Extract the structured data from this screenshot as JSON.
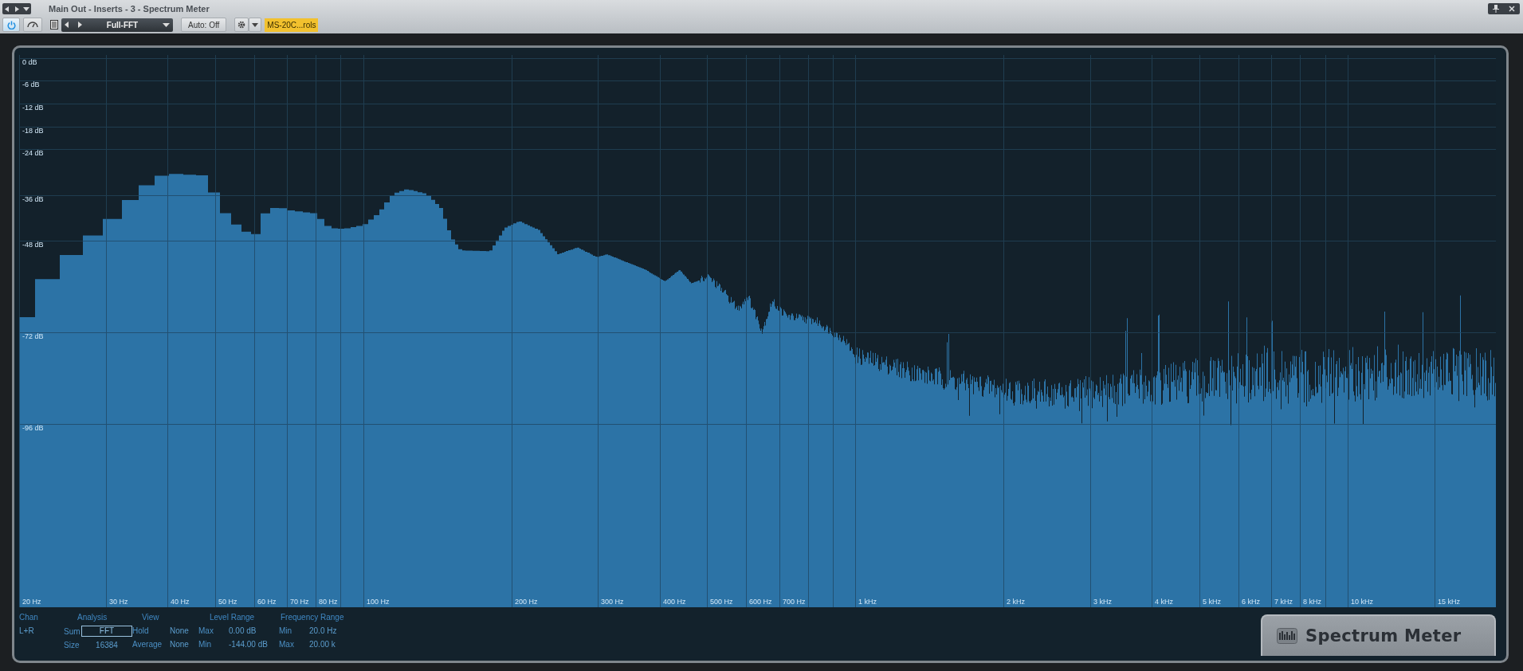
{
  "window": {
    "title": "Main Out - Inserts - 3 - Spectrum Meter"
  },
  "toolbar": {
    "power": {
      "on": true
    },
    "preset": {
      "name": "Full-FFT"
    },
    "auto_button": "Auto: Off",
    "device_tag": "MS-20C...rols"
  },
  "chart": {
    "y_labels": [
      "0 dB",
      "-6 dB",
      "-12 dB",
      "-18 dB",
      "-24 dB",
      "-36 dB",
      "-48 dB",
      "-72 dB",
      "-96 dB"
    ],
    "x_labels": [
      "20 Hz",
      "30 Hz",
      "40 Hz",
      "50 Hz",
      "60 Hz",
      "70 Hz",
      "80 Hz",
      "100 Hz",
      "200 Hz",
      "300 Hz",
      "400 Hz",
      "500 Hz",
      "600 Hz",
      "700 Hz",
      "1 kHz",
      "2 kHz",
      "3 kHz",
      "4 kHz",
      "5 kHz",
      "6 kHz",
      "7 kHz",
      "8 kHz",
      "10 kHz",
      "15 kHz"
    ]
  },
  "settings": [
    {
      "header": "Chan",
      "rows": [
        {
          "value": "L+R",
          "kind": "plain"
        }
      ]
    },
    {
      "header": "Analysis",
      "rows": [
        {
          "label": "Sum",
          "value": "FFT",
          "kind": "box"
        },
        {
          "label": "Size",
          "value": "16384",
          "kind": "plain"
        }
      ]
    },
    {
      "header": "View",
      "rows": [
        {
          "label": "Hold",
          "value": "None",
          "kind": "plain"
        },
        {
          "label": "Average",
          "value": "None",
          "kind": "plain"
        }
      ]
    },
    {
      "header": "Level Range",
      "rows": [
        {
          "label": "Max",
          "value": "0.00 dB",
          "kind": "plain"
        },
        {
          "label": "Min",
          "value": "-144.00 dB",
          "kind": "plain"
        }
      ]
    },
    {
      "header": "Frequency Range",
      "rows": [
        {
          "label": "Min",
          "value": "20.0 Hz",
          "kind": "plain"
        },
        {
          "label": "Max",
          "value": "20.00 k",
          "kind": "plain"
        }
      ]
    }
  ],
  "logo": {
    "text": "Spectrum Meter"
  }
}
